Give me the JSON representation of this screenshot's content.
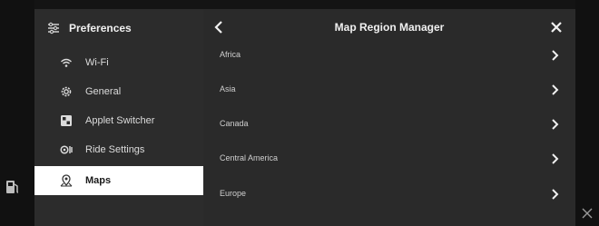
{
  "sidebar": {
    "title": "Preferences",
    "items": [
      {
        "label": "Wi-Fi",
        "icon": "wifi-icon"
      },
      {
        "label": "General",
        "icon": "gear-icon"
      },
      {
        "label": "Applet Switcher",
        "icon": "applet-switcher-icon"
      },
      {
        "label": "Ride Settings",
        "icon": "ride-settings-icon"
      },
      {
        "label": "Maps",
        "icon": "map-icon"
      }
    ]
  },
  "main": {
    "title": "Map Region Manager",
    "regions": [
      {
        "label": "Africa"
      },
      {
        "label": "Asia"
      },
      {
        "label": "Canada"
      },
      {
        "label": "Central America"
      },
      {
        "label": "Europe"
      }
    ]
  },
  "colors": {
    "background": "#141414",
    "panel": "#2b2b2b",
    "active_item": "#ffffff",
    "text": "#e6e6e6"
  }
}
